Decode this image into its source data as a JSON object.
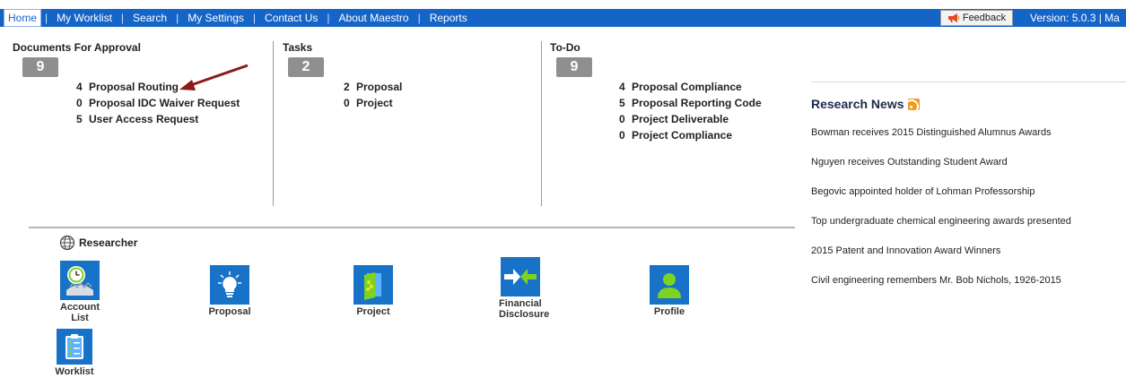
{
  "nav": {
    "items": [
      "Home",
      "My Worklist",
      "Search",
      "My Settings",
      "Contact Us",
      "About Maestro",
      "Reports"
    ],
    "feedback_label": "Feedback",
    "version_text": "Version: 5.0.3  | Ma"
  },
  "approval": {
    "title": "Documents For Approval",
    "count": "9",
    "items": [
      {
        "n": "4",
        "label": "Proposal Routing"
      },
      {
        "n": "0",
        "label": "Proposal IDC Waiver Request"
      },
      {
        "n": "5",
        "label": "User Access Request"
      }
    ]
  },
  "tasks": {
    "title": "Tasks",
    "count": "2",
    "items": [
      {
        "n": "2",
        "label": "Proposal"
      },
      {
        "n": "0",
        "label": "Project"
      }
    ]
  },
  "todo": {
    "title": "To-Do",
    "count": "9",
    "items": [
      {
        "n": "4",
        "label": "Proposal Compliance"
      },
      {
        "n": "5",
        "label": "Proposal Reporting Code"
      },
      {
        "n": "0",
        "label": "Project Deliverable"
      },
      {
        "n": "0",
        "label": "Project Compliance"
      }
    ]
  },
  "news": {
    "title": "Research News",
    "items": [
      "Bowman receives 2015 Distinguished Alumnus Awards",
      "Nguyen receives Outstanding Student Award",
      "Begovic appointed holder of Lohman Professorship",
      "Top undergraduate chemical engineering awards presented",
      "2015 Patent and Innovation Award Winners",
      "Civil engineering remembers Mr. Bob Nichols, 1926-2015"
    ]
  },
  "researcher": {
    "title": "Researcher",
    "tiles": [
      {
        "label1": "Account",
        "label2": "List",
        "icon": "clock-icon"
      },
      {
        "label1": "Proposal",
        "label2": "",
        "icon": "lightbulb-icon"
      },
      {
        "label1": "Project",
        "label2": "",
        "icon": "book-icon"
      },
      {
        "label1": "Financial",
        "label2": "Disclosure",
        "icon": "arrows-icon"
      },
      {
        "label1": "Profile",
        "label2": "",
        "icon": "person-icon"
      },
      {
        "label1": "Worklist",
        "label2": "",
        "icon": "clipboard-icon"
      }
    ]
  },
  "colors": {
    "nav_bg": "#1565c9",
    "count_box": "#8f8f8f",
    "tile_bg": "#1872c7",
    "arrow": "#8b1a1a"
  }
}
